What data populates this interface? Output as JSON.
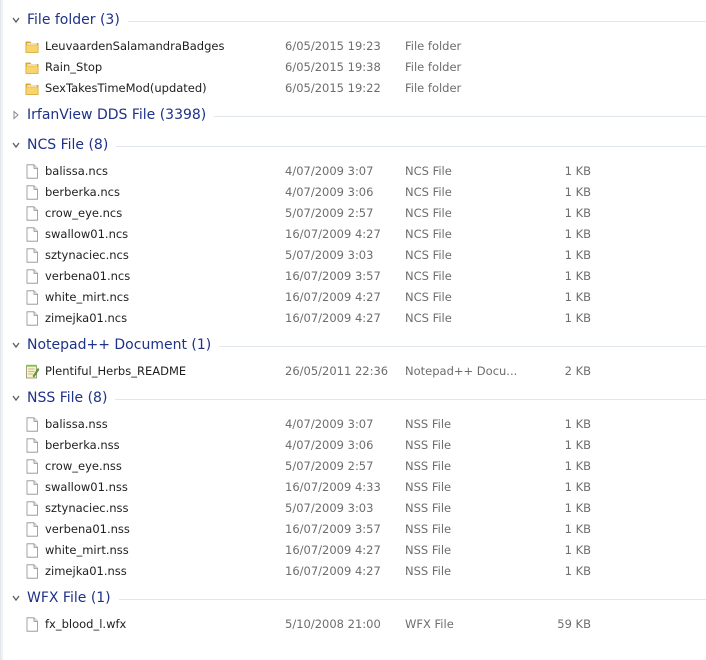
{
  "groups": [
    {
      "title": "File folder (3)",
      "expanded": true,
      "items": [
        {
          "icon": "folder-icon",
          "name": "LeuvaardenSalamandraBadges",
          "date": "6/05/2015 19:23",
          "type": "File folder",
          "size": ""
        },
        {
          "icon": "folder-icon",
          "name": "Rain_Stop",
          "date": "6/05/2015 19:38",
          "type": "File folder",
          "size": ""
        },
        {
          "icon": "folder-icon",
          "name": "SexTakesTimeMod(updated)",
          "date": "6/05/2015 19:22",
          "type": "File folder",
          "size": ""
        }
      ]
    },
    {
      "title": "IrfanView DDS File (3398)",
      "expanded": false,
      "items": []
    },
    {
      "title": "NCS File (8)",
      "expanded": true,
      "items": [
        {
          "icon": "file-icon",
          "name": "balissa.ncs",
          "date": "4/07/2009 3:07",
          "type": "NCS File",
          "size": "1 KB"
        },
        {
          "icon": "file-icon",
          "name": "berberka.ncs",
          "date": "4/07/2009 3:06",
          "type": "NCS File",
          "size": "1 KB"
        },
        {
          "icon": "file-icon",
          "name": "crow_eye.ncs",
          "date": "5/07/2009 2:57",
          "type": "NCS File",
          "size": "1 KB"
        },
        {
          "icon": "file-icon",
          "name": "swallow01.ncs",
          "date": "16/07/2009 4:27",
          "type": "NCS File",
          "size": "1 KB"
        },
        {
          "icon": "file-icon",
          "name": "sztynaciec.ncs",
          "date": "5/07/2009 3:03",
          "type": "NCS File",
          "size": "1 KB"
        },
        {
          "icon": "file-icon",
          "name": "verbena01.ncs",
          "date": "16/07/2009 3:57",
          "type": "NCS File",
          "size": "1 KB"
        },
        {
          "icon": "file-icon",
          "name": "white_mirt.ncs",
          "date": "16/07/2009 4:27",
          "type": "NCS File",
          "size": "1 KB"
        },
        {
          "icon": "file-icon",
          "name": "zimejka01.ncs",
          "date": "16/07/2009 4:27",
          "type": "NCS File",
          "size": "1 KB"
        }
      ]
    },
    {
      "title": "Notepad++ Document (1)",
      "expanded": true,
      "items": [
        {
          "icon": "notepad-icon",
          "name": "Plentiful_Herbs_README",
          "date": "26/05/2011 22:36",
          "type": "Notepad++ Docu...",
          "size": "2 KB"
        }
      ]
    },
    {
      "title": "NSS File (8)",
      "expanded": true,
      "items": [
        {
          "icon": "file-icon",
          "name": "balissa.nss",
          "date": "4/07/2009 3:07",
          "type": "NSS File",
          "size": "1 KB"
        },
        {
          "icon": "file-icon",
          "name": "berberka.nss",
          "date": "4/07/2009 3:06",
          "type": "NSS File",
          "size": "1 KB"
        },
        {
          "icon": "file-icon",
          "name": "crow_eye.nss",
          "date": "5/07/2009 2:57",
          "type": "NSS File",
          "size": "1 KB"
        },
        {
          "icon": "file-icon",
          "name": "swallow01.nss",
          "date": "16/07/2009 4:33",
          "type": "NSS File",
          "size": "1 KB"
        },
        {
          "icon": "file-icon",
          "name": "sztynaciec.nss",
          "date": "5/07/2009 3:03",
          "type": "NSS File",
          "size": "1 KB"
        },
        {
          "icon": "file-icon",
          "name": "verbena01.nss",
          "date": "16/07/2009 3:57",
          "type": "NSS File",
          "size": "1 KB"
        },
        {
          "icon": "file-icon",
          "name": "white_mirt.nss",
          "date": "16/07/2009 4:27",
          "type": "NSS File",
          "size": "1 KB"
        },
        {
          "icon": "file-icon",
          "name": "zimejka01.nss",
          "date": "16/07/2009 4:27",
          "type": "NSS File",
          "size": "1 KB"
        }
      ]
    },
    {
      "title": "WFX File (1)",
      "expanded": true,
      "items": [
        {
          "icon": "file-icon",
          "name": "fx_blood_l.wfx",
          "date": "5/10/2008 21:00",
          "type": "WFX File",
          "size": "59 KB"
        }
      ]
    }
  ],
  "colors": {
    "group_title": "#1e3287",
    "group_line": "#e2e6ed",
    "detail_text": "#6d6d6d",
    "name_text": "#1e1e1e",
    "folder_body": "#f2c84b"
  }
}
